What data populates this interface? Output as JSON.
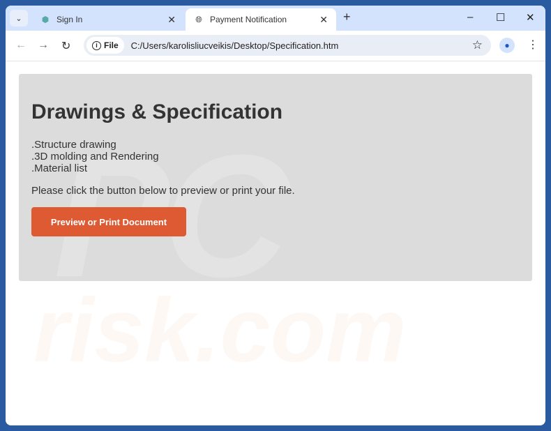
{
  "browser": {
    "tabs": [
      {
        "label": "Sign In",
        "icon": "cube-icon",
        "active": false
      },
      {
        "label": "Payment Notification",
        "icon": "globe-icon",
        "active": true
      }
    ],
    "address": {
      "chip_label": "File",
      "url": "C:/Users/karolisliucveikis/Desktop/Specification.htm"
    }
  },
  "page": {
    "title": "Drawings & Specification",
    "items": [
      ".Structure drawing",
      ".3D molding and Rendering",
      ".Material list"
    ],
    "message": "Please click the button below to preview or print your file.",
    "button_label": "Preview or Print Document",
    "button_color": "#dd5a33"
  },
  "watermark": {
    "line1": "PC",
    "line2": "risk.com"
  }
}
